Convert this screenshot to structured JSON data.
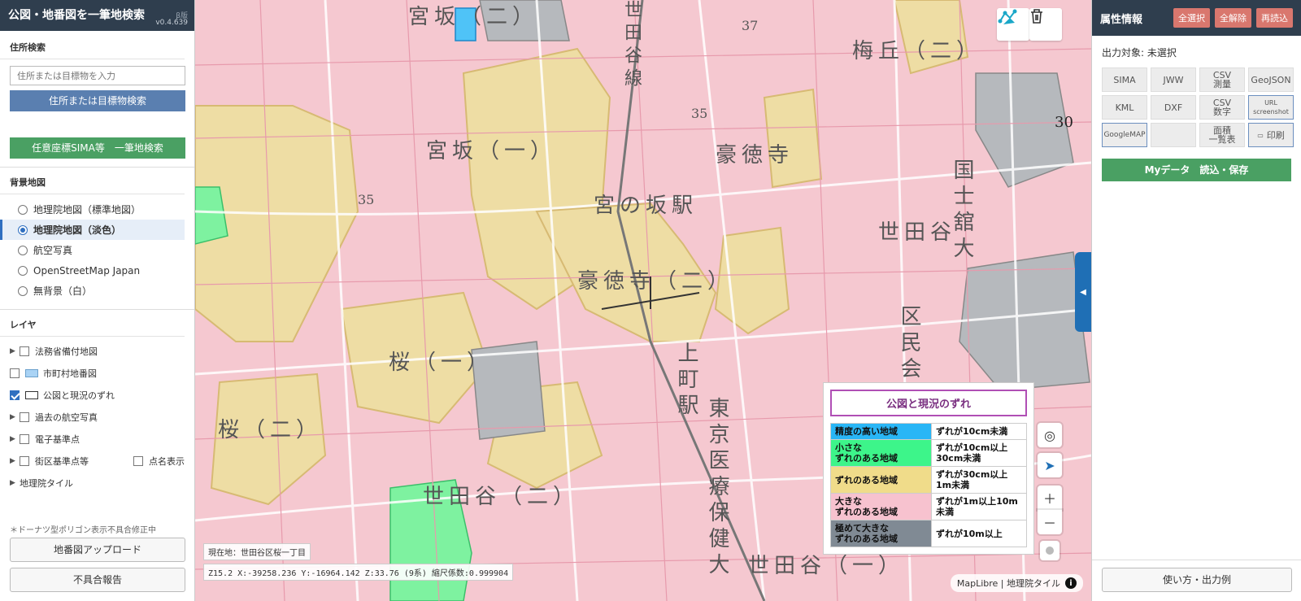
{
  "app": {
    "title": "公図・地番図を一筆地検索",
    "beta": "β版",
    "version": "v0.4.639"
  },
  "address": {
    "heading": "住所検索",
    "placeholder": "住所または目標物を入力",
    "search_label": "住所または目標物検索",
    "sima_label": "任意座標SIMA等　一筆地検索"
  },
  "basemap": {
    "heading": "背景地図",
    "options": [
      {
        "label": "地理院地図（標準地図）",
        "selected": false
      },
      {
        "label": "地理院地図（淡色）",
        "selected": true
      },
      {
        "label": "航空写真",
        "selected": false
      },
      {
        "label": "OpenStreetMap Japan",
        "selected": false
      },
      {
        "label": "無背景（白）",
        "selected": false
      }
    ]
  },
  "layers": {
    "heading": "レイヤ",
    "items": [
      {
        "label": "法務省備付地図",
        "checked": false
      },
      {
        "label": "市町村地番図",
        "checked": false
      },
      {
        "label": "公図と現況のずれ",
        "checked": true
      },
      {
        "label": "過去の航空写真",
        "checked": false
      },
      {
        "label": "電子基準点",
        "checked": false
      },
      {
        "label": "街区基準点等",
        "checked": false
      },
      {
        "label": "点名表示",
        "checked": false
      },
      {
        "label": "地理院タイル"
      }
    ]
  },
  "footer_left": {
    "note": "＊ドーナツ型ポリゴン表示不具合修正中",
    "upload_label": "地番図アップロード",
    "report_label": "不具合報告"
  },
  "map": {
    "labels": [
      "宮坂（二）",
      "梅丘（二）",
      "宮坂（一）",
      "豪徳寺",
      "宮の坂駅",
      "世田谷",
      "国士舘大",
      "豪徳寺（二）",
      "区民会",
      "桜（一）",
      "桜（二）",
      "上町駅",
      "東京医療保健大",
      "世田谷（二）",
      "世田谷（一）",
      "世田谷線"
    ],
    "numbers": [
      "35",
      "37",
      "30",
      "35"
    ],
    "location": "現在地：世田谷区桜一丁目",
    "coordinates": "Z15.2  X:-39258.236 Y:-16964.142 Z:33.76 (9系) 縮尺係数:0.999904",
    "attribution": "MapLibre | 地理院タイル"
  },
  "legend": {
    "title": "公図と現況のずれ",
    "rows": [
      {
        "label": "精度の高い地域",
        "desc": "ずれが10cm未満",
        "color": "#29b6f6"
      },
      {
        "label": "小さな\nずれのある地域",
        "desc": "ずれが10cm以上\n30cm未満",
        "color": "#3df58a"
      },
      {
        "label": "ずれのある地域",
        "desc": "ずれが30cm以上\n1m未満",
        "color": "#f0dc8a"
      },
      {
        "label": "大きな\nずれのある地域",
        "desc": "ずれが1m以上10m\n未満",
        "color": "#f7c2cf"
      },
      {
        "label": "極めて大きな\nずれのある地域",
        "desc": "ずれが10m以上",
        "color": "#808a94"
      }
    ]
  },
  "attributes": {
    "title": "属性情報",
    "select_all": "全選択",
    "deselect_all": "全解除",
    "reload": "再読込",
    "target": "出力対象: 未選択",
    "buttons": [
      "SIMA",
      "JWW",
      "CSV\n測量",
      "GeoJSON",
      "KML",
      "DXF",
      "CSV\n数字",
      "URL\nscreenshot",
      "GoogleMAP",
      "",
      "面積\n一覧表",
      "印刷"
    ],
    "mydata_label": "Myデータ　読込・保存",
    "help_label": "使い方・出力例"
  }
}
